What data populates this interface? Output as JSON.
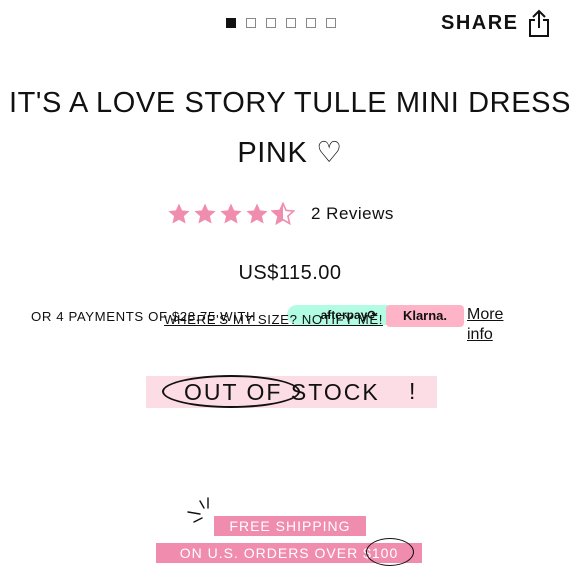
{
  "gallery": {
    "dots": [
      true,
      false,
      false,
      false,
      false,
      false
    ]
  },
  "share": {
    "label": "SHARE",
    "icon": "share-icon"
  },
  "product": {
    "title": "IT'S A LOVE STORY TULLE MINI DRESS PINK ♡",
    "rating": 4.5,
    "reviews_label": "2 Reviews",
    "price": "US$115.00"
  },
  "payments": {
    "text": "OR 4 PAYMENTS OF $28.75 WITH",
    "afterpay": "afterpay⟳",
    "klarna": "Klarna.",
    "more_info": "More info"
  },
  "size_link": "WHERE'S MY SIZE? NOTIFY ME!",
  "stock": {
    "label": "OUT OF STOCK",
    "bang": "!"
  },
  "shipping": {
    "line1": "FREE SHIPPING",
    "line2": "ON U.S. ORDERS OVER $100"
  },
  "colors": {
    "pink": "#f08cae",
    "light_pink": "#fcdde6",
    "star": "#f08cae"
  }
}
